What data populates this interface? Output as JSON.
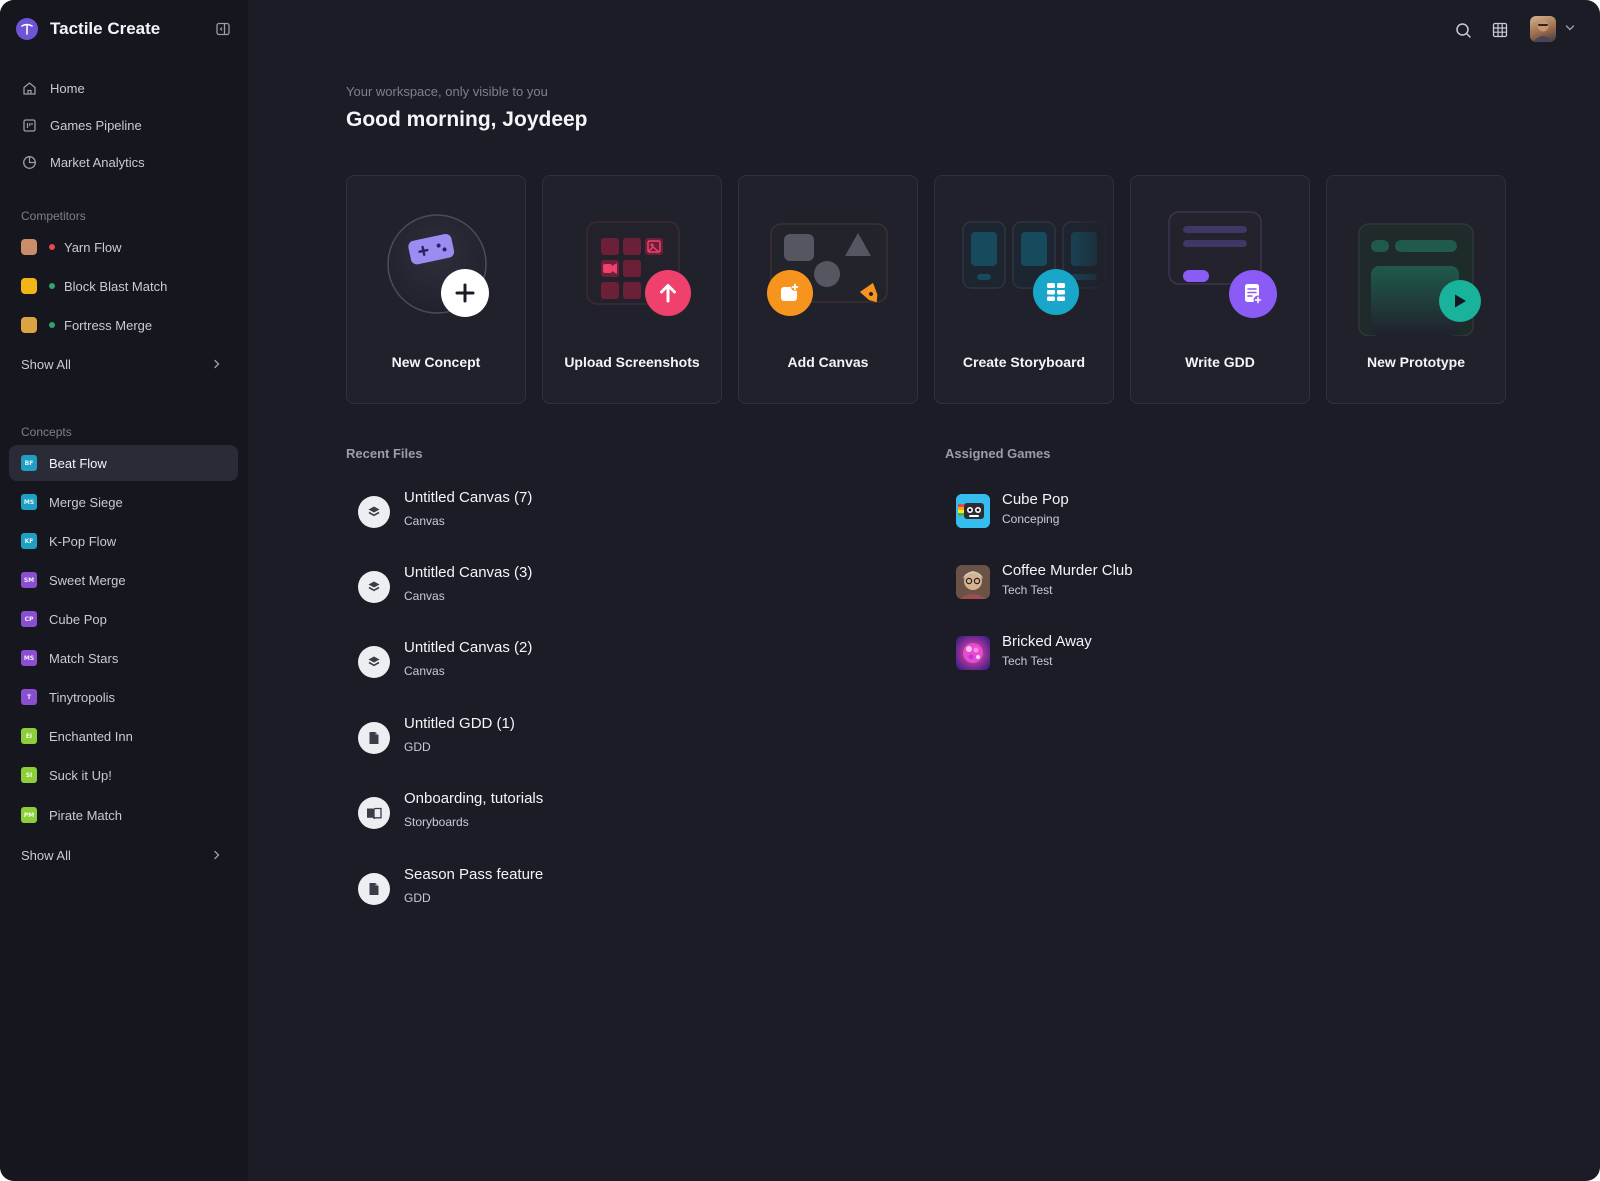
{
  "app": {
    "name": "Tactile Create"
  },
  "nav": [
    {
      "id": "home",
      "label": "Home",
      "icon": "home-icon"
    },
    {
      "id": "games-pipeline",
      "label": "Games Pipeline",
      "icon": "board-icon"
    },
    {
      "id": "market-analytics",
      "label": "Market Analytics",
      "icon": "pie-chart-icon"
    }
  ],
  "competitors": {
    "title": "Competitors",
    "items": [
      {
        "label": "Yarn Flow",
        "status_color": "#e5484d",
        "avatar_color": "#c98d6a"
      },
      {
        "label": "Block Blast Match",
        "status_color": "#30a46c",
        "avatar_color": "#f1b518"
      },
      {
        "label": "Fortress Merge",
        "status_color": "#30a46c",
        "avatar_color": "#d9a441"
      }
    ],
    "show_all": "Show All"
  },
  "concepts": {
    "title": "Concepts",
    "items": [
      {
        "label": "Beat Flow",
        "abbr": "BF",
        "color": "#1f9fc4",
        "active": true
      },
      {
        "label": "Merge Siege",
        "abbr": "MS",
        "color": "#1f9fc4"
      },
      {
        "label": "K-Pop Flow",
        "abbr": "KF",
        "color": "#1f9fc4"
      },
      {
        "label": "Sweet Merge",
        "abbr": "SM",
        "color": "#8a4fd0"
      },
      {
        "label": "Cube Pop",
        "abbr": "CP",
        "color": "#8a4fd0"
      },
      {
        "label": "Match Stars",
        "abbr": "MS",
        "color": "#8a4fd0"
      },
      {
        "label": "Tinytropolis",
        "abbr": "T",
        "color": "#8a4fd0"
      },
      {
        "label": "Enchanted Inn",
        "abbr": "EI",
        "color": "#8ccf3a"
      },
      {
        "label": "Suck it Up!",
        "abbr": "SI",
        "color": "#8ccf3a"
      },
      {
        "label": "Pirate Match",
        "abbr": "PM",
        "color": "#8ccf3a"
      }
    ],
    "show_all": "Show All"
  },
  "header": {
    "kicker": "Your workspace, only visible to you",
    "greeting": "Good morning, Joydeep"
  },
  "quick_actions": [
    {
      "label": "New Concept",
      "icon": "plus-icon",
      "accent": "#ffffff"
    },
    {
      "label": "Upload Screenshots",
      "icon": "upload-arrow-icon",
      "accent": "#f0416c"
    },
    {
      "label": "Add Canvas",
      "icon": "add-image-icon",
      "accent": "#f7941d"
    },
    {
      "label": "Create Storyboard",
      "icon": "grid-icon",
      "accent": "#18a7c9"
    },
    {
      "label": "Write GDD",
      "icon": "document-add-icon",
      "accent": "#8a5cf5"
    },
    {
      "label": "New Prototype",
      "icon": "play-icon",
      "accent": "#18b39a"
    }
  ],
  "recent_files": {
    "title": "Recent Files",
    "items": [
      {
        "title": "Untitled Canvas (7)",
        "type": "Canvas",
        "icon": "layers-icon"
      },
      {
        "title": "Untitled Canvas (3)",
        "type": "Canvas",
        "icon": "layers-icon"
      },
      {
        "title": "Untitled Canvas (2)",
        "type": "Canvas",
        "icon": "layers-icon"
      },
      {
        "title": "Untitled GDD (1)",
        "type": "GDD",
        "icon": "document-icon"
      },
      {
        "title": "Onboarding, tutorials",
        "type": "Storyboards",
        "icon": "book-icon"
      },
      {
        "title": "Season Pass feature",
        "type": "GDD",
        "icon": "document-icon"
      }
    ]
  },
  "assigned_games": {
    "title": "Assigned Games",
    "items": [
      {
        "title": "Cube Pop",
        "status": "Conceping"
      },
      {
        "title": "Coffee Murder Club",
        "status": "Tech Test"
      },
      {
        "title": "Bricked Away",
        "status": "Tech Test"
      }
    ]
  },
  "colors": {
    "background": "#1b1c25",
    "sidebar": "#15161e",
    "card": "#20212b",
    "brand": "#6f54d6"
  }
}
